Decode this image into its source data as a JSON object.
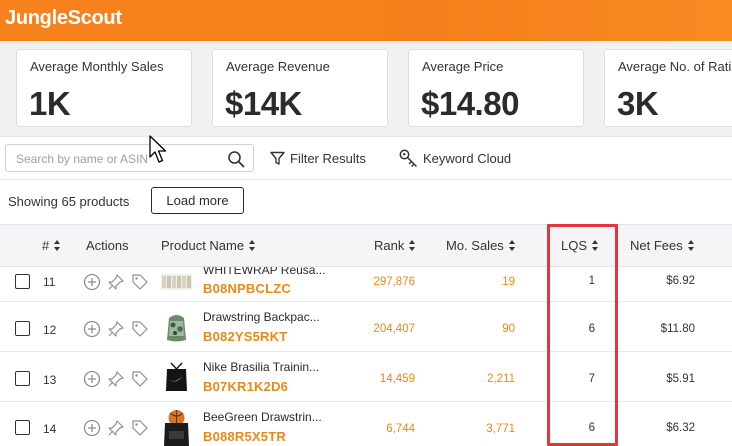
{
  "app": {
    "logo": "JungleScout"
  },
  "stats": [
    {
      "label": "Average Monthly Sales",
      "value": "1K"
    },
    {
      "label": "Average Revenue",
      "value": "$14K"
    },
    {
      "label": "Average Price",
      "value": "$14.80"
    },
    {
      "label": "Average No. of Ratings",
      "value": "3K"
    }
  ],
  "toolbar": {
    "search_placeholder": "Search by name or ASIN",
    "filter_label": "Filter Results",
    "keyword_label": "Keyword Cloud"
  },
  "summary": {
    "showing": "Showing 65 products",
    "load_more": "Load more"
  },
  "columns": {
    "num": "#",
    "actions": "Actions",
    "product": "Product Name",
    "rank": "Rank",
    "sales": "Mo. Sales",
    "lqs": "LQS",
    "fees": "Net Fees"
  },
  "rows": [
    {
      "num": "11",
      "name": "WHITEWRAP Reusa...",
      "asin": "B08NPBCLZC",
      "rank": "297,876",
      "sales": "19",
      "lqs": "1",
      "fees": "$6.92"
    },
    {
      "num": "12",
      "name": "Drawstring Backpac...",
      "asin": "B082YS5RKT",
      "rank": "204,407",
      "sales": "90",
      "lqs": "6",
      "fees": "$11.80"
    },
    {
      "num": "13",
      "name": "Nike Brasilia Trainin...",
      "asin": "B07KR1K2D6",
      "rank": "14,459",
      "sales": "2,211",
      "lqs": "7",
      "fees": "$5.91"
    },
    {
      "num": "14",
      "name": "BeeGreen Drawstrin...",
      "asin": "B088R5X5TR",
      "rank": "6,744",
      "sales": "3,771",
      "lqs": "6",
      "fees": "$6.32"
    }
  ],
  "colors": {
    "brand": "#f7821d",
    "asin": "#e8891a",
    "highlight": "#e2353e"
  }
}
